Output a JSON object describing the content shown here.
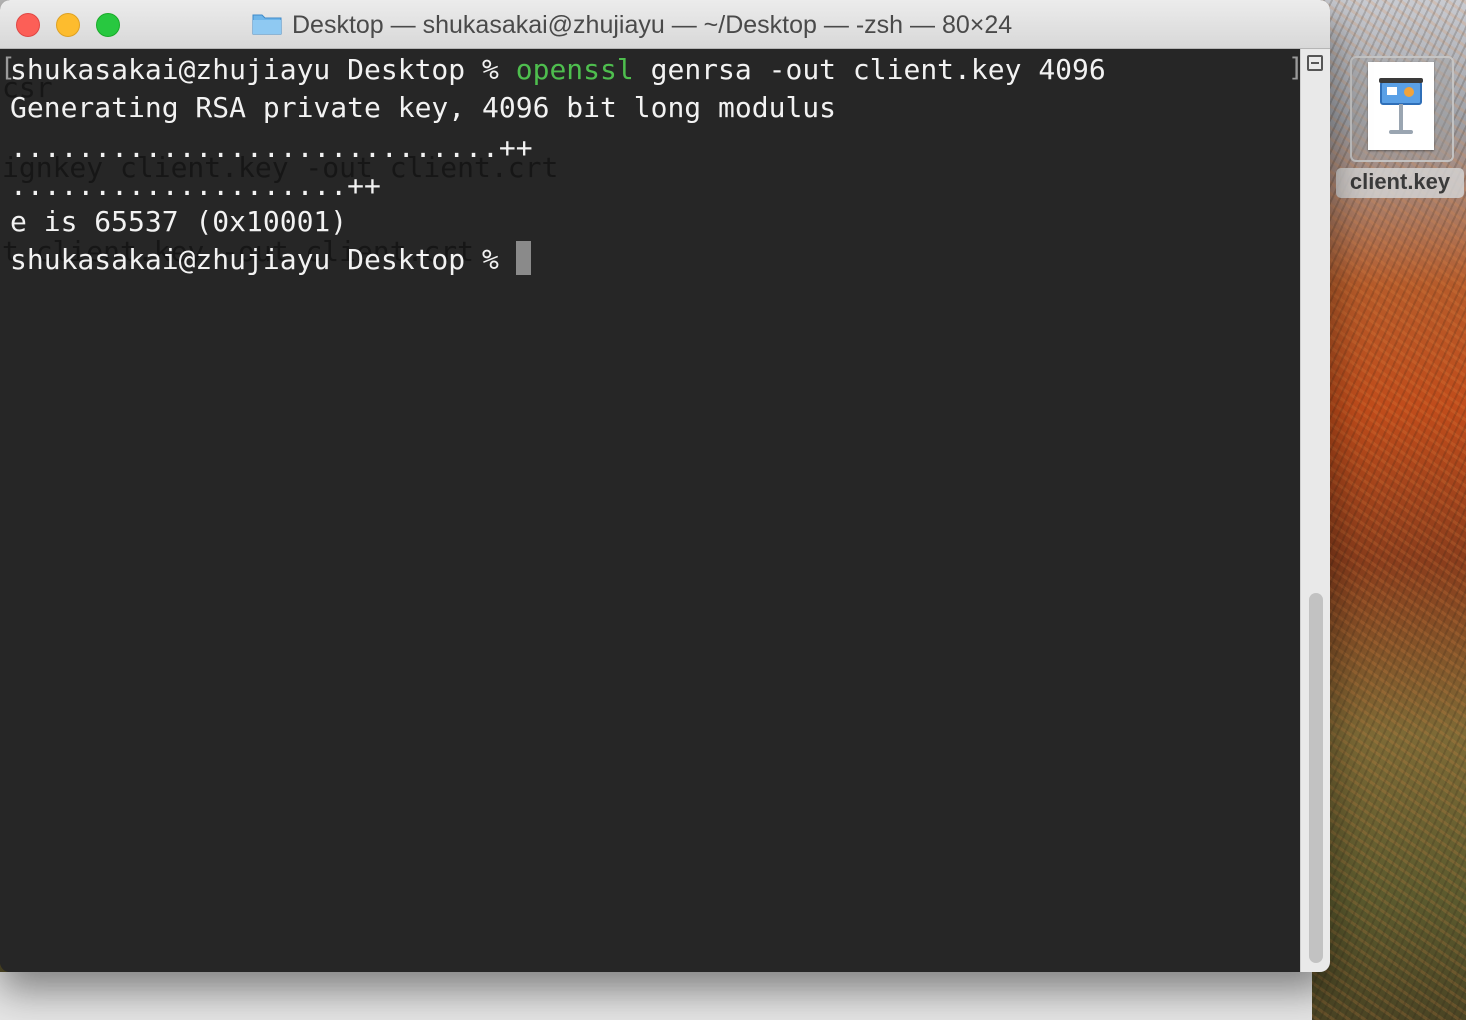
{
  "window": {
    "title": "Desktop — shukasakai@zhujiayu — ~/Desktop — -zsh — 80×24"
  },
  "terminal": {
    "ghost_lines": [
      "csr",
      "ignkey client.key -out client.crt",
      "t client.key -out client.crt"
    ],
    "line1_prompt": "shukasakai@zhujiayu Desktop % ",
    "line1_cmd": "openssl",
    "line1_args": " genrsa -out client.key 4096",
    "line2": "Generating RSA private key, 4096 bit long modulus",
    "line3": ".............................++",
    "line4": "....................++",
    "line5": "e is 65537 (0x10001)",
    "line6_prompt": "shukasakai@zhujiayu Desktop % ",
    "command_color": "#4ebe4e"
  },
  "desktop": {
    "icon_label": "client.key",
    "icon_name": "keynote-document-icon"
  }
}
